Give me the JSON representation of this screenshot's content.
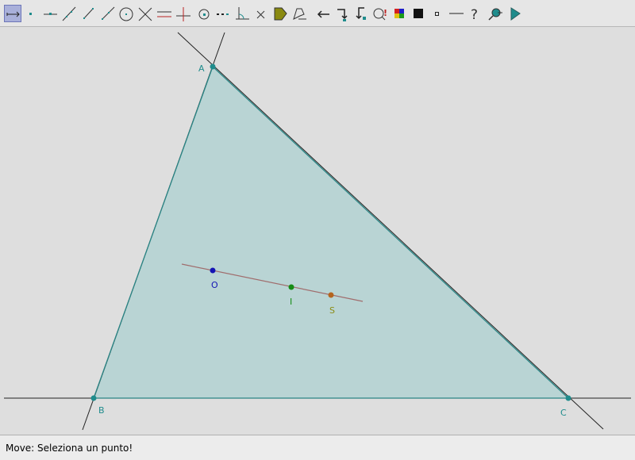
{
  "toolbar": {
    "tools": [
      {
        "id": "move",
        "icon": "move-arrow-icon",
        "selected": true
      },
      {
        "id": "point",
        "icon": "point-icon"
      },
      {
        "id": "point-on-object",
        "icon": "point-on-line-icon"
      },
      {
        "id": "line",
        "icon": "line-icon"
      },
      {
        "id": "segment",
        "icon": "segment-icon"
      },
      {
        "id": "ray",
        "icon": "ray-icon"
      },
      {
        "id": "circle",
        "icon": "circle-icon"
      },
      {
        "id": "intersection",
        "icon": "intersection-icon"
      },
      {
        "id": "parallel",
        "icon": "parallel-line-icon"
      },
      {
        "id": "perpendicular",
        "icon": "perpendicular-line-icon"
      },
      {
        "id": "midpoint",
        "icon": "midpoint-icon"
      },
      {
        "id": "locus",
        "icon": "dotted-line-icon"
      },
      {
        "id": "angle",
        "icon": "angle-icon"
      },
      {
        "id": "delete",
        "icon": "cross-icon"
      },
      {
        "id": "polygon",
        "icon": "polygon-icon"
      },
      {
        "id": "macro",
        "icon": "macro-icon"
      },
      {
        "id": "back",
        "icon": "back-arrow-icon"
      },
      {
        "id": "rename",
        "icon": "rename-icon"
      },
      {
        "id": "hide",
        "icon": "hide-icon"
      },
      {
        "id": "info",
        "icon": "info-icon"
      },
      {
        "id": "color",
        "icon": "color-palette-icon"
      },
      {
        "id": "fill",
        "icon": "fill-square-icon"
      },
      {
        "id": "point-style",
        "icon": "small-square-icon"
      },
      {
        "id": "line-style",
        "icon": "line-style-icon"
      },
      {
        "id": "help",
        "icon": "question-mark-icon",
        "glyph": "?"
      },
      {
        "id": "zoom",
        "icon": "magnifier-icon"
      },
      {
        "id": "run",
        "icon": "play-icon"
      }
    ]
  },
  "points": {
    "A": {
      "label": "A",
      "color": "#1f8c8c"
    },
    "B": {
      "label": "B",
      "color": "#1f8c8c"
    },
    "C": {
      "label": "C",
      "color": "#1f8c8c"
    },
    "O": {
      "label": "O",
      "color": "#1414b4"
    },
    "I": {
      "label": "I",
      "color": "#148c14"
    },
    "S": {
      "label": "S",
      "color": "#b4641e"
    }
  },
  "colors": {
    "triangle_fill": "#b9d4d4",
    "triangle_edge": "#2a8585",
    "extension_line": "#222222",
    "euler_line": "#a06d6d"
  },
  "status": {
    "message": "Move: Seleziona un punto!"
  }
}
